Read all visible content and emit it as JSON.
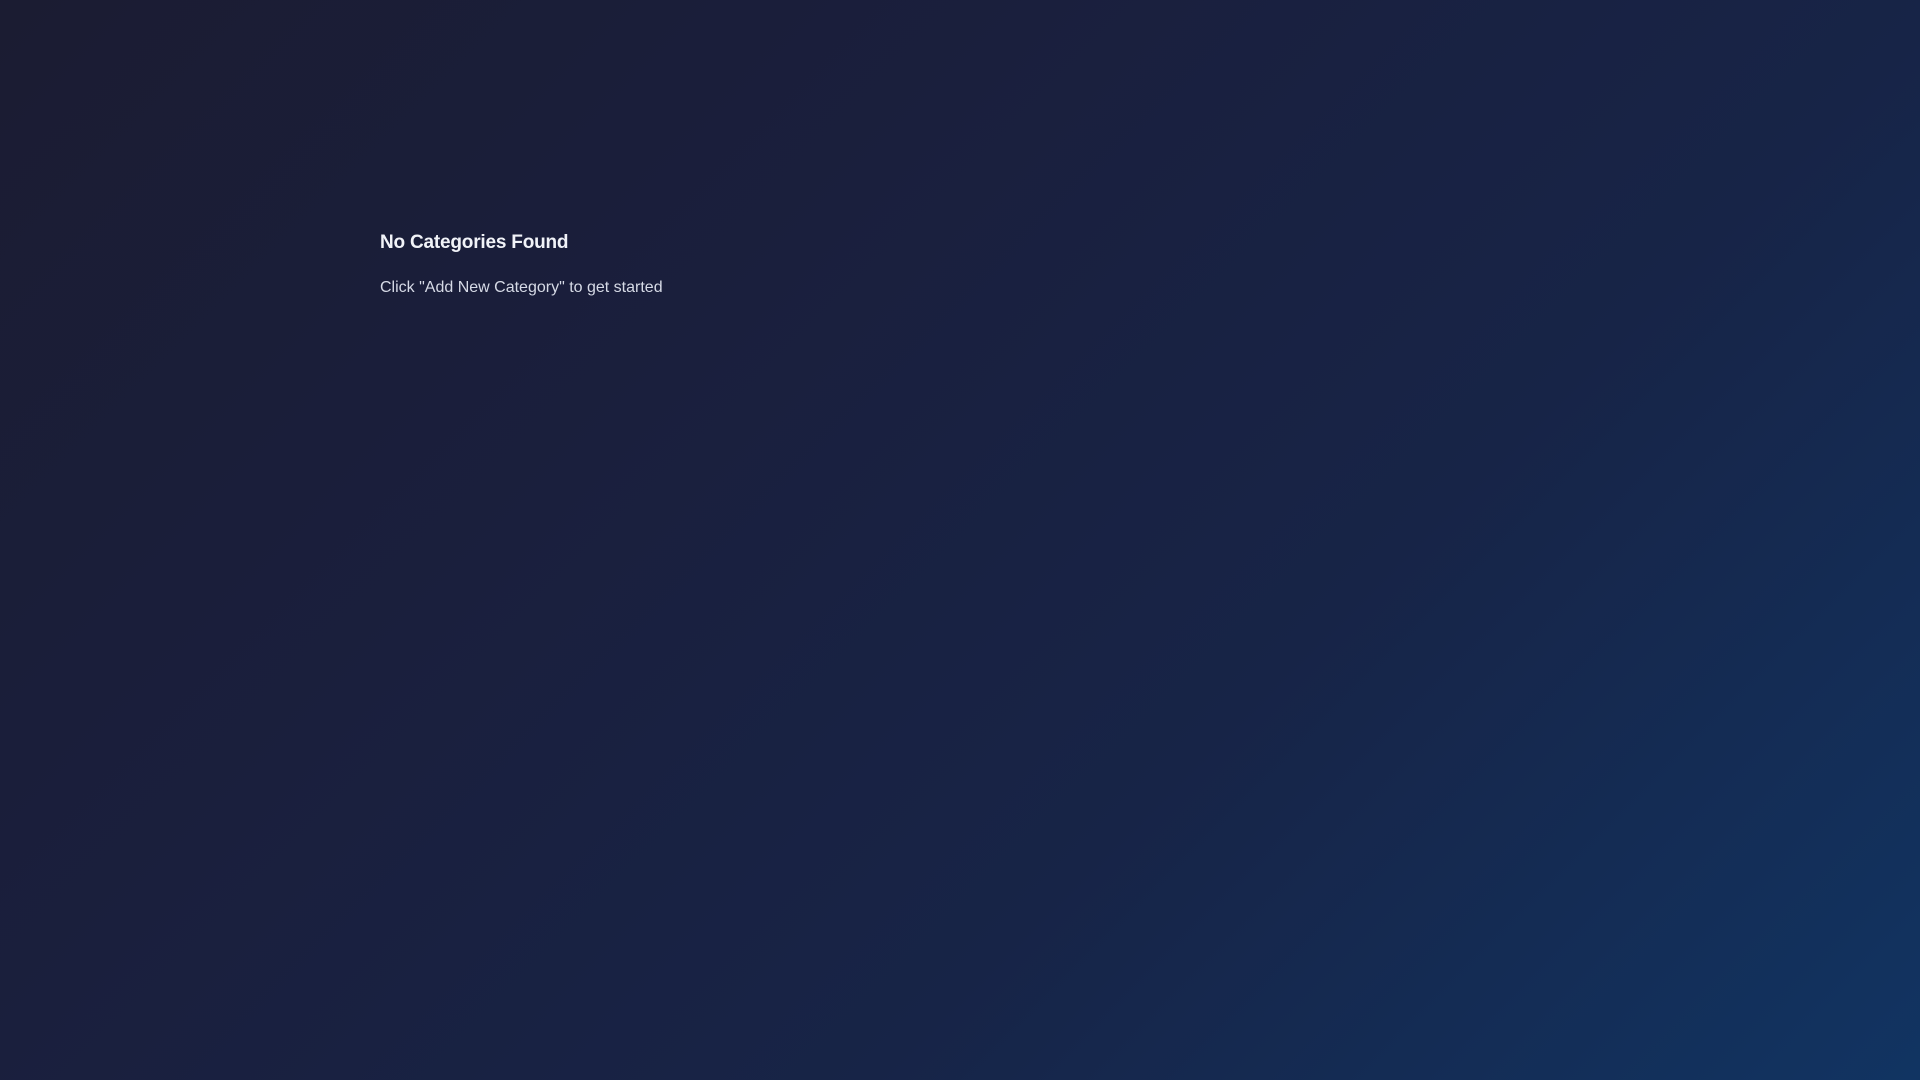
{
  "empty_state": {
    "title": "No Categories Found",
    "subtitle": "Click \"Add New Category\" to get started"
  },
  "colors": {
    "background_start": "#1b1c32",
    "background_end": "#113462",
    "title_text": "#f1f3f8",
    "subtitle_text": "#d6dae6"
  }
}
